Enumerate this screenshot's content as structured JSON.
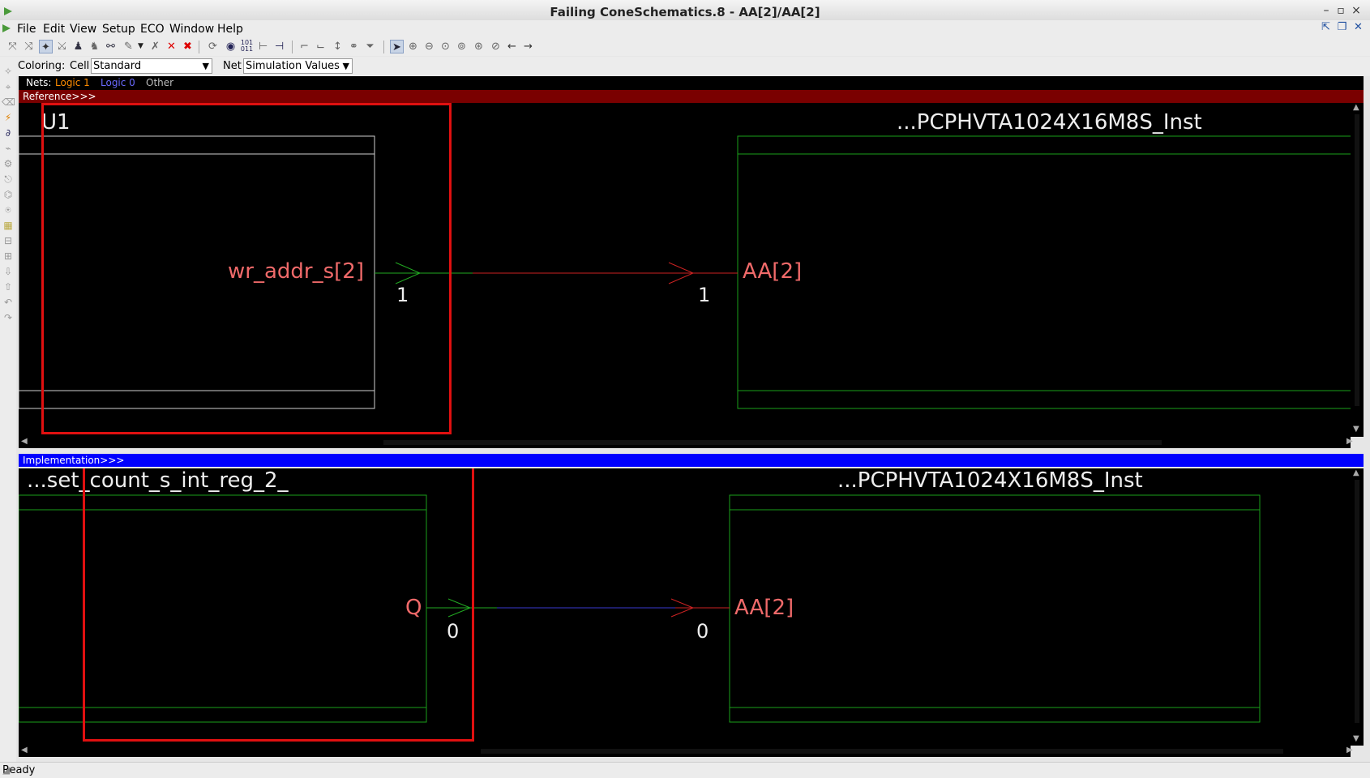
{
  "window": {
    "title": "Failing ConeSchematics.8 - AA[2]/AA[2]",
    "controls": [
      "–",
      "▫",
      "×"
    ]
  },
  "menu": {
    "items": [
      "File",
      "Edit",
      "View",
      "Setup",
      "ECO",
      "Window",
      "Help"
    ]
  },
  "coloring": {
    "label": "Coloring:",
    "cell_label": "Cell",
    "cell_value": "Standard",
    "net_label": "Net",
    "net_value": "Simulation Values"
  },
  "legend": {
    "nets_label": "Nets:",
    "logic1": "Logic 1",
    "logic0": "Logic 0",
    "other": "Other",
    "colors": {
      "logic1": "#ff8c00",
      "logic0": "#6a6aff",
      "other": "#bbbbbb"
    }
  },
  "reference": {
    "header": "Reference>>>",
    "header_color": "#7a0000",
    "source_cell": "U1",
    "source_pin": "wr_addr_s[2]",
    "source_value": "1",
    "target_cell": "...PCPHVTA1024X16M8S_Inst",
    "target_pin": "AA[2]",
    "target_value": "1"
  },
  "implementation": {
    "header": "Implementation>>>",
    "header_color": "#0000ff",
    "source_cell": "...set_count_s_int_reg_2_",
    "source_pin": "Q",
    "source_value": "0",
    "target_cell": "...PCPHVTA1024X16M8S_Inst",
    "target_pin": "AA[2]",
    "target_value": "0"
  },
  "status": {
    "text": "Ready"
  }
}
